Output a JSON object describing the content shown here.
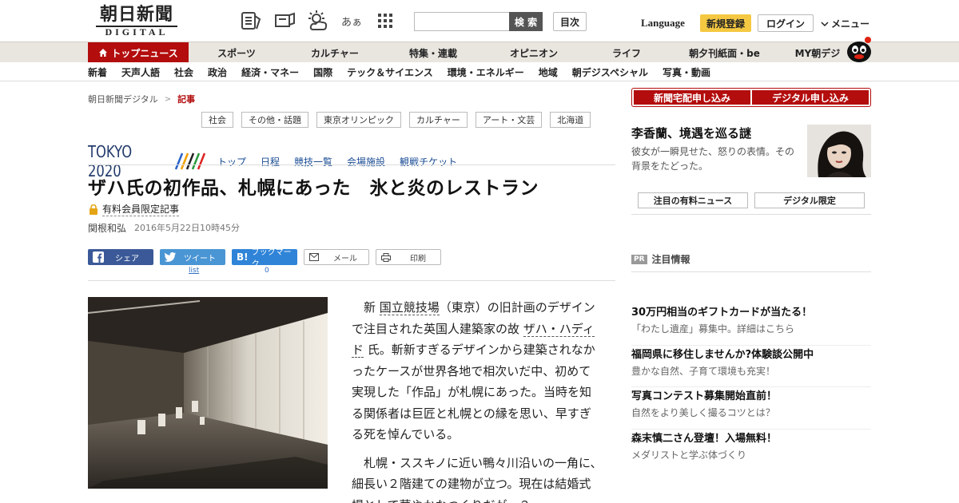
{
  "header": {
    "logo_kanji": "朝日新聞",
    "logo_digital": "DIGITAL",
    "font_size_label": "あぁ",
    "search_placeholder": "",
    "search_label": "検 索",
    "toc_label": "目次",
    "language_label": "Language",
    "register_label": "新規登録",
    "login_label": "ログイン",
    "menu_label": "メニュー"
  },
  "nav1": {
    "items": [
      "トップニュース",
      "スポーツ",
      "カルチャー",
      "特集・連載",
      "オピニオン",
      "ライフ",
      "朝夕刊紙面・be",
      "MY朝デジ"
    ]
  },
  "nav2": {
    "items": [
      "新着",
      "天声人語",
      "社会",
      "政治",
      "経済・マネー",
      "国際",
      "テック＆サイエンス",
      "環境・エネルギー",
      "地域",
      "朝デジスペシャル",
      "写真・動画"
    ]
  },
  "breadcrumb": {
    "root": "朝日新聞デジタル",
    "sep": ">",
    "current": "記事"
  },
  "tags": [
    "社会",
    "その他・話題",
    "東京オリンピック",
    "カルチャー",
    "アート・文芸",
    "北海道"
  ],
  "tokyo": {
    "logo": "TOKYO 2020",
    "links": [
      "トップ",
      "日程",
      "競技一覧",
      "会場施設",
      "観戦チケット"
    ]
  },
  "article": {
    "title": "ザハ氏の初作品、札幌にあった　氷と炎のレストラン",
    "paid_label": "有料会員限定記事",
    "author": "関根和弘",
    "date": "2016年5月22日10時45分",
    "p1_a": "新 ",
    "p1_link1": "国立競技場",
    "p1_b": "（東京）の旧計画のデザインで注目された英国人建築家の故 ",
    "p1_link2": "ザハ・ハディド",
    "p1_c": " 氏。斬新すぎるデザインから建築されなかったケースが世界各地で相次いだ中、初めて実現した「作品」が札幌にあった。当時を知る関係者は巨匠と札幌との縁を思い、早すぎる死を悼んでいる。",
    "p2": "札幌・ススキノに近い鴨々川沿いの一角に、細長い２階建ての建物が立つ。現在は結婚式場として華やかなつくりだが、２"
  },
  "share": {
    "facebook": "シェア",
    "twitter": "ツイート",
    "hatena": "ブックマーク",
    "mail": "メール",
    "print": "印刷",
    "twitter_count": "list",
    "hatena_count": "0"
  },
  "sidebar": {
    "subscribe_paper": "新聞宅配申し込み",
    "subscribe_digital": "デジタル申し込み",
    "feature_title": "李香蘭、境遇を巡る謎",
    "feature_desc": "彼女が一瞬見せた、怒りの表情。その背景をたどった。",
    "tab1": "注目の有料ニュース",
    "tab2": "デジタル限定",
    "pr_badge": "PR",
    "pr_label": "注目情報",
    "ads": [
      {
        "title": "30万円相当のギフトカードが当たる！",
        "desc": "「わたし遺産」募集中。詳細はこちら"
      },
      {
        "title": "福岡県に移住しませんか?体験談公開中",
        "desc": "豊かな自然、子育て環境も充実！"
      },
      {
        "title": "写真コンテスト募集開始直前！",
        "desc": "自然をより美しく撮るコツとは？"
      },
      {
        "title": "森末慎二さん登壇！入場無料！",
        "desc": "メダリストと学ぶ体づくり"
      }
    ]
  },
  "colors": {
    "brand_red": "#b30d0d",
    "register_yellow": "#f5c842",
    "link_blue": "#1a4c95"
  }
}
